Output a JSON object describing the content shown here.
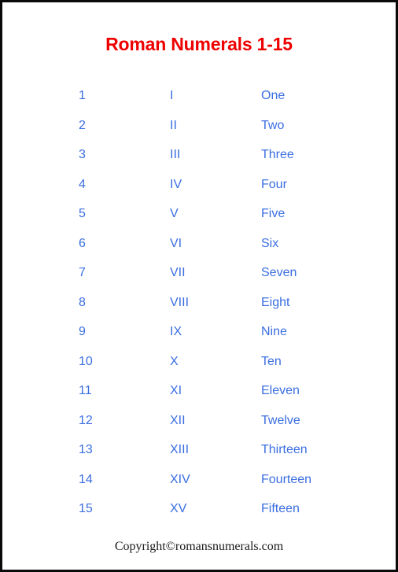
{
  "page": {
    "title": "Roman Numerals 1-15",
    "title_color": "#ee0000",
    "text_color": "#3a6ee0",
    "border_color": "#0a0a0a",
    "background_color": "#ffffff"
  },
  "footer": {
    "copyright": "Copyright©romansnumerals.com"
  },
  "table": {
    "rows": [
      {
        "number": "1",
        "roman": "I",
        "word": "One"
      },
      {
        "number": "2",
        "roman": "II",
        "word": "Two"
      },
      {
        "number": "3",
        "roman": "III",
        "word": "Three"
      },
      {
        "number": "4",
        "roman": "IV",
        "word": "Four"
      },
      {
        "number": "5",
        "roman": "V",
        "word": "Five"
      },
      {
        "number": "6",
        "roman": "VI",
        "word": "Six"
      },
      {
        "number": "7",
        "roman": "VII",
        "word": "Seven"
      },
      {
        "number": "8",
        "roman": "VIII",
        "word": "Eight"
      },
      {
        "number": "9",
        "roman": "IX",
        "word": "Nine"
      },
      {
        "number": "10",
        "roman": "X",
        "word": "Ten"
      },
      {
        "number": "11",
        "roman": "XI",
        "word": "Eleven"
      },
      {
        "number": "12",
        "roman": "XII",
        "word": "Twelve"
      },
      {
        "number": "13",
        "roman": "XIII",
        "word": "Thirteen"
      },
      {
        "number": "14",
        "roman": "XIV",
        "word": "Fourteen"
      },
      {
        "number": "15",
        "roman": "XV",
        "word": "Fifteen"
      }
    ]
  }
}
